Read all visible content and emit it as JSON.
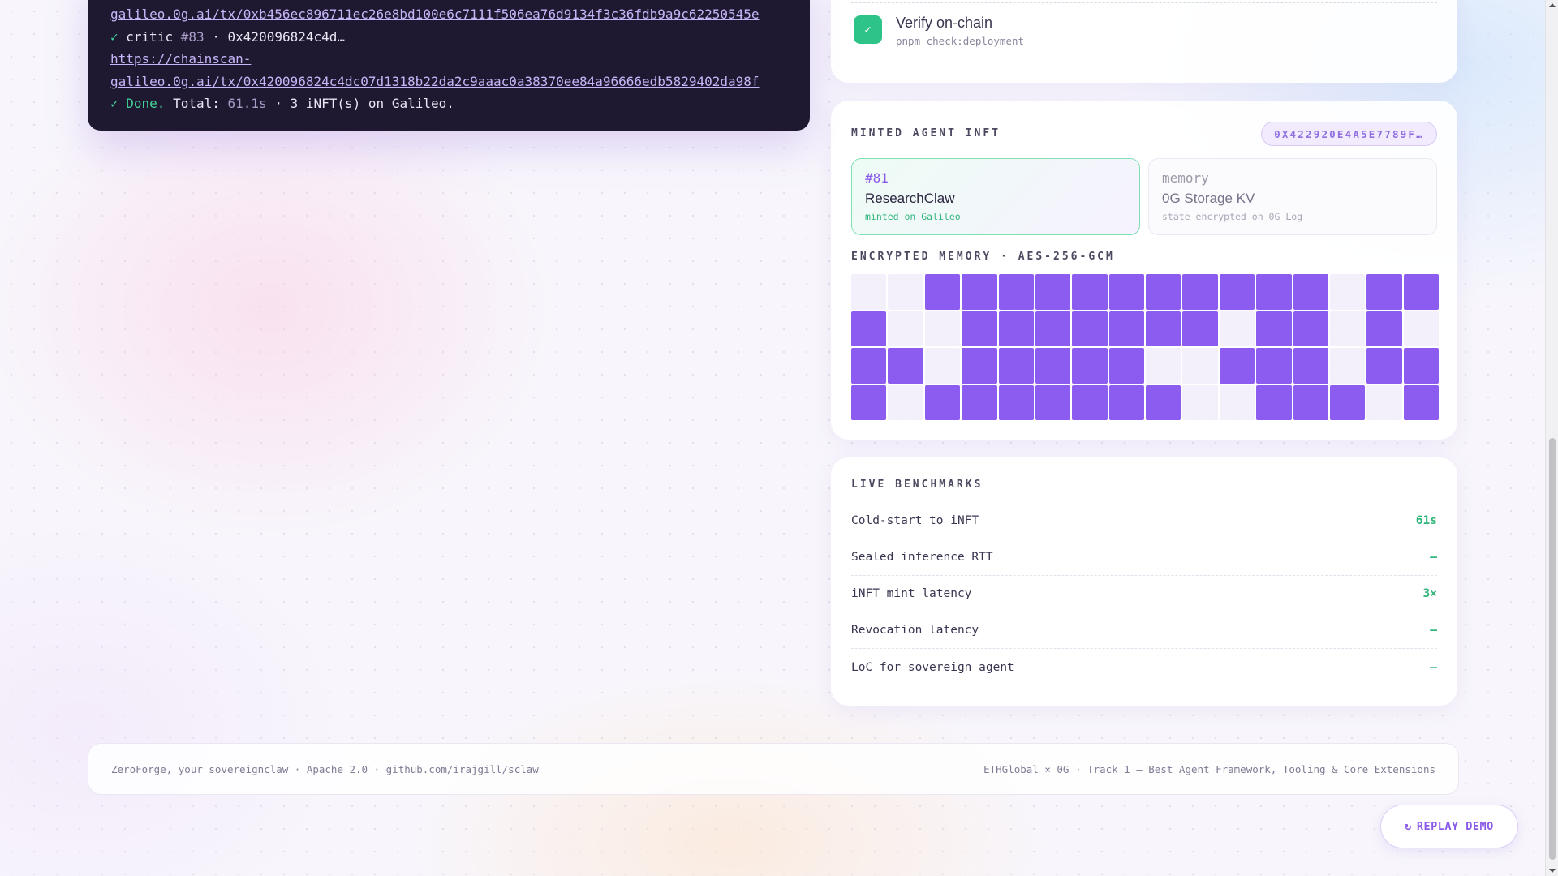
{
  "terminal": {
    "line1_link": "galileo.0g.ai/tx/0xb456ec896711ec26e8bd100e6c7111f506ea76d9134f3c36fdb9a9c62250545e",
    "line2_tick": "✓",
    "line2_text": "critic",
    "line2_num": "#83",
    "line2_rest": "· 0x420096824c4d…",
    "line3_link": "https://chainscan-",
    "line4_link": "galileo.0g.ai/tx/0x420096824c4dc07d1318b22da2c9aaac0a38370ee84a96666edb5829402da98f",
    "line5_tick": "✓ Done.",
    "line5_total": "Total:",
    "line5_time": "61.1s",
    "line5_rest": "· 3 iNFT(s) on Galileo."
  },
  "verify": {
    "check": "✓",
    "title": "Verify on-chain",
    "command": "pnpm check:deployment"
  },
  "minted": {
    "label": "MINTED AGENT INFT",
    "hash": "0X422920E4A5E7789F…",
    "agent": {
      "id": "#81",
      "name": "ResearchClaw",
      "sub": "minted on Galileo"
    },
    "memory": {
      "id": "memory",
      "name": "0G Storage KV",
      "sub": "state encrypted on 0G Log"
    },
    "encrypted_label": "ENCRYPTED MEMORY · AES-256-GCM",
    "grid": [
      [
        0,
        0,
        1,
        1,
        1,
        1,
        1,
        1,
        1,
        1,
        1,
        1,
        1,
        0,
        1,
        1
      ],
      [
        1,
        0,
        0,
        1,
        1,
        1,
        1,
        1,
        1,
        1,
        0,
        1,
        1,
        0,
        1,
        0
      ],
      [
        1,
        1,
        0,
        1,
        1,
        1,
        1,
        1,
        0,
        0,
        1,
        1,
        1,
        0,
        1,
        1
      ],
      [
        1,
        0,
        1,
        1,
        1,
        1,
        1,
        1,
        1,
        0,
        0,
        1,
        1,
        1,
        0,
        1
      ]
    ]
  },
  "benchmarks": {
    "label": "LIVE BENCHMARKS",
    "rows": [
      {
        "label": "Cold-start to iNFT",
        "value": "61s"
      },
      {
        "label": "Sealed inference RTT",
        "value": "—"
      },
      {
        "label": "iNFT mint latency",
        "value": "3×"
      },
      {
        "label": "Revocation latency",
        "value": "—"
      },
      {
        "label": "LoC for sovereign agent",
        "value": "—"
      }
    ]
  },
  "footer": {
    "left": "ZeroForge, your sovereignclaw · Apache 2.0 · github.com/irajgill/sclaw",
    "right": "ETHGlobal × 0G · Track 1 — Best Agent Framework, Tooling & Core Extensions"
  },
  "replay": {
    "icon": "↻",
    "label": "REPLAY DEMO"
  },
  "colors": {
    "accent": "#8c5cf0",
    "success": "#2ec488",
    "terminal_bg": "#1e1830"
  }
}
